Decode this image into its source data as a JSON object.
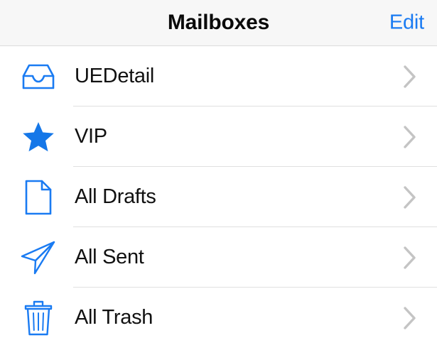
{
  "navbar": {
    "title": "Mailboxes",
    "edit_label": "Edit",
    "background_color": "#f7f7f7",
    "title_color": "#0a0a0a",
    "accent_color": "#1a7bf2"
  },
  "colors": {
    "icon_blue": "#1a7bf2",
    "chevron_gray": "#c4c4c4",
    "separator": "#e0e0e0",
    "row_background": "#ffffff",
    "label_text": "#111111"
  },
  "mailboxes": [
    {
      "label": "UEDetail",
      "icon": "inbox-tray-icon"
    },
    {
      "label": "VIP",
      "icon": "star-filled-icon"
    },
    {
      "label": "All Drafts",
      "icon": "document-page-icon"
    },
    {
      "label": "All Sent",
      "icon": "paper-plane-icon"
    },
    {
      "label": "All Trash",
      "icon": "trash-can-icon"
    }
  ],
  "accessory": {
    "icon": "chevron-right-icon"
  }
}
